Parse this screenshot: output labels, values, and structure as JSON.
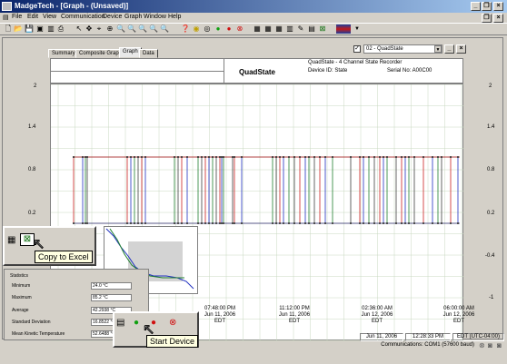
{
  "window": {
    "title": "MadgeTech - [Graph - (Unsaved)]"
  },
  "menu": [
    "File",
    "Edit",
    "View",
    "Communication",
    "Device",
    "Graph",
    "Window",
    "Help"
  ],
  "tabs": [
    "Summary",
    "Composite Graph",
    "Graph",
    "Data"
  ],
  "series_selector": {
    "value": "02 - QuadState"
  },
  "info": {
    "name": "QuadState",
    "model": "QuadState - 4 Channel State Recorder",
    "device_id": "Device ID: State",
    "serial": "Serial No: A00C00"
  },
  "left_axis": [
    "2",
    "1.4",
    "0.8",
    "0.2"
  ],
  "right_axis": [
    "2",
    "1.4",
    "0.8",
    "0.2",
    "-0.4",
    "-1"
  ],
  "x_ticks": [
    {
      "time": "07:48:00 PM",
      "date": "Jun 11, 2006",
      "tz": "EDT"
    },
    {
      "time": "11:12:00 PM",
      "date": "Jun 11, 2006",
      "tz": "EDT"
    },
    {
      "time": "02:36:00 AM",
      "date": "Jun 12, 2006",
      "tz": "EDT"
    },
    {
      "time": "06:00:00 AM",
      "date": "Jun 12, 2006",
      "tz": "EDT"
    }
  ],
  "tooltips": {
    "copy": "Copy to Excel",
    "start": "Start Device"
  },
  "stats": {
    "title": "Statistics",
    "rows": [
      {
        "label": "Minimum",
        "value": "24.0 °C"
      },
      {
        "label": "Maximum",
        "value": "85.2 °C"
      },
      {
        "label": "Average",
        "value": "42.2938 °C"
      },
      {
        "label": "Standard Deviation",
        "value": "16.8522 °C"
      },
      {
        "label": "Mean Kinetic Temperature",
        "value": "52.6488 °C"
      }
    ]
  },
  "status": {
    "date": "Jun 11, 2006",
    "time": "12:28:33 PM",
    "tz": "EDT (UTC-04:00)",
    "comm": "Communications: COM1 (57600 baud)"
  },
  "colors": {
    "red": "#cc2020",
    "blue": "#2030c0",
    "green": "#208030",
    "grid": "#c8d8c0"
  }
}
